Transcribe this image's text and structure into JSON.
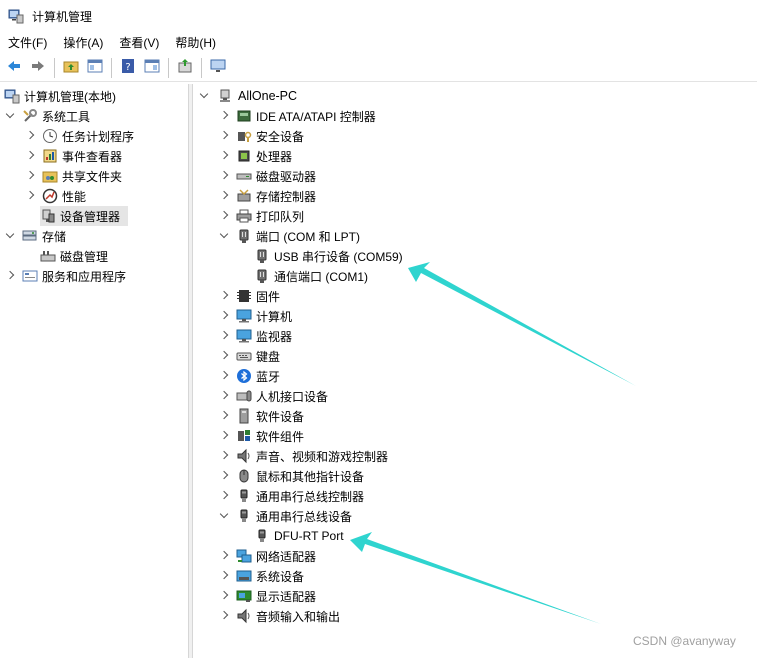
{
  "window": {
    "title": "计算机管理"
  },
  "menu": [
    "文件(F)",
    "操作(A)",
    "查看(V)",
    "帮助(H)"
  ],
  "toolbar": [
    "back-icon",
    "forward-icon",
    "up-folder-icon",
    "console-tree-icon",
    "help-icon",
    "action-pane-icon",
    "update-driver-icon",
    "monitor-icon"
  ],
  "left_tree": {
    "root": "计算机管理(本地)",
    "system_tools": "系统工具",
    "task_scheduler": "任务计划程序",
    "event_viewer": "事件查看器",
    "shared_folders": "共享文件夹",
    "performance": "性能",
    "device_manager": "设备管理器",
    "storage": "存储",
    "disk_management": "磁盘管理",
    "services_apps": "服务和应用程序"
  },
  "device_tree": {
    "root": "AllOne-PC",
    "categories": [
      {
        "label": "IDE ATA/ATAPI 控制器",
        "icon": "ide-controller-icon",
        "expanded": false
      },
      {
        "label": "安全设备",
        "icon": "security-device-icon",
        "expanded": false
      },
      {
        "label": "处理器",
        "icon": "processor-icon",
        "expanded": false
      },
      {
        "label": "磁盘驱动器",
        "icon": "disk-drive-icon",
        "expanded": false
      },
      {
        "label": "存储控制器",
        "icon": "storage-controller-icon",
        "expanded": false
      },
      {
        "label": "打印队列",
        "icon": "printer-icon",
        "expanded": false
      },
      {
        "label": "端口 (COM 和 LPT)",
        "icon": "port-icon",
        "expanded": true,
        "children": [
          {
            "label": "USB 串行设备 (COM59)",
            "icon": "port-icon"
          },
          {
            "label": "通信端口 (COM1)",
            "icon": "port-icon"
          }
        ]
      },
      {
        "label": "固件",
        "icon": "firmware-icon",
        "expanded": false
      },
      {
        "label": "计算机",
        "icon": "computer-icon",
        "expanded": false
      },
      {
        "label": "监视器",
        "icon": "monitor-icon",
        "expanded": false
      },
      {
        "label": "键盘",
        "icon": "keyboard-icon",
        "expanded": false
      },
      {
        "label": "蓝牙",
        "icon": "bluetooth-icon",
        "expanded": false
      },
      {
        "label": "人机接口设备",
        "icon": "hid-icon",
        "expanded": false
      },
      {
        "label": "软件设备",
        "icon": "software-device-icon",
        "expanded": false
      },
      {
        "label": "软件组件",
        "icon": "software-component-icon",
        "expanded": false
      },
      {
        "label": "声音、视频和游戏控制器",
        "icon": "speaker-icon",
        "expanded": false
      },
      {
        "label": "鼠标和其他指针设备",
        "icon": "mouse-icon",
        "expanded": false
      },
      {
        "label": "通用串行总线控制器",
        "icon": "usb-icon",
        "expanded": false
      },
      {
        "label": "通用串行总线设备",
        "icon": "usb-icon",
        "expanded": true,
        "children": [
          {
            "label": "DFU-RT Port",
            "icon": "usb-icon"
          }
        ]
      },
      {
        "label": "网络适配器",
        "icon": "network-adapter-icon",
        "expanded": false
      },
      {
        "label": "系统设备",
        "icon": "system-device-icon",
        "expanded": false
      },
      {
        "label": "显示适配器",
        "icon": "display-adapter-icon",
        "expanded": false
      },
      {
        "label": "音频输入和输出",
        "icon": "audio-io-icon",
        "expanded": false
      }
    ]
  },
  "annotation_color": "#2fd4cf",
  "watermark": "CSDN @avanyway"
}
